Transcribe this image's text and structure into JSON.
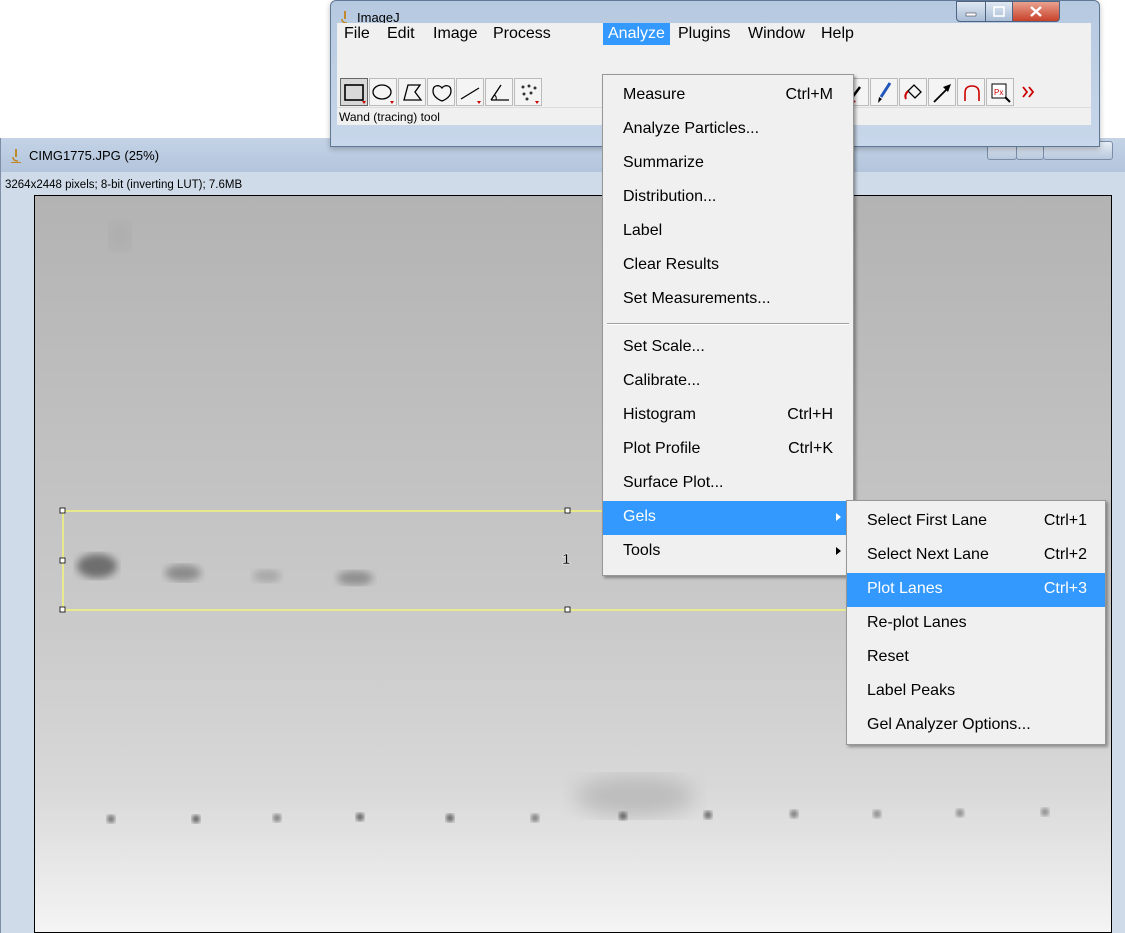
{
  "main_window": {
    "title": "ImageJ",
    "menus": [
      "File",
      "Edit",
      "Image",
      "Process",
      "Analyze",
      "Plugins",
      "Window",
      "Help"
    ],
    "active_menu": "Analyze",
    "status": "Wand (tracing) tool",
    "toolbar_icons": [
      "rectangle-tool-icon",
      "oval-tool-icon",
      "polygon-tool-icon",
      "freehand-tool-icon",
      "line-tool-icon",
      "angle-tool-icon",
      "multipoint-tool-icon",
      "dropper-tool-icon",
      "brush-tool-icon",
      "flood-fill-tool-icon",
      "arrow-tool-icon",
      "wand-tool-icon",
      "pixel-inspector-icon",
      "more-tools-icon"
    ]
  },
  "image_window": {
    "title": "CIMG1775.JPG (25%)",
    "info": "3264x2448 pixels; 8-bit (inverting LUT); 7.6MB",
    "lane_label": "1"
  },
  "analyze_menu": {
    "items": [
      {
        "label": "Measure",
        "shortcut": "Ctrl+M"
      },
      {
        "label": "Analyze Particles...",
        "shortcut": ""
      },
      {
        "label": "Summarize",
        "shortcut": ""
      },
      {
        "label": "Distribution...",
        "shortcut": ""
      },
      {
        "label": "Label",
        "shortcut": ""
      },
      {
        "label": "Clear Results",
        "shortcut": ""
      },
      {
        "label": "Set Measurements...",
        "shortcut": ""
      },
      {
        "label": "Set Scale...",
        "shortcut": ""
      },
      {
        "label": "Calibrate...",
        "shortcut": ""
      },
      {
        "label": "Histogram",
        "shortcut": "Ctrl+H"
      },
      {
        "label": "Plot Profile",
        "shortcut": "Ctrl+K"
      },
      {
        "label": "Surface Plot...",
        "shortcut": ""
      },
      {
        "label": "Gels",
        "shortcut": ""
      },
      {
        "label": "Tools",
        "shortcut": ""
      }
    ],
    "highlighted": "Gels"
  },
  "gels_menu": {
    "items": [
      {
        "label": "Select First Lane",
        "shortcut": "Ctrl+1"
      },
      {
        "label": "Select Next Lane",
        "shortcut": "Ctrl+2"
      },
      {
        "label": "Plot Lanes",
        "shortcut": "Ctrl+3"
      },
      {
        "label": "Re-plot Lanes",
        "shortcut": ""
      },
      {
        "label": "Reset",
        "shortcut": ""
      },
      {
        "label": "Label Peaks",
        "shortcut": ""
      },
      {
        "label": "Gel Analyzer Options...",
        "shortcut": ""
      }
    ],
    "highlighted": "Plot Lanes"
  },
  "colors": {
    "menu_highlight": "#3399ff",
    "selection_outline": "#ffff66"
  }
}
